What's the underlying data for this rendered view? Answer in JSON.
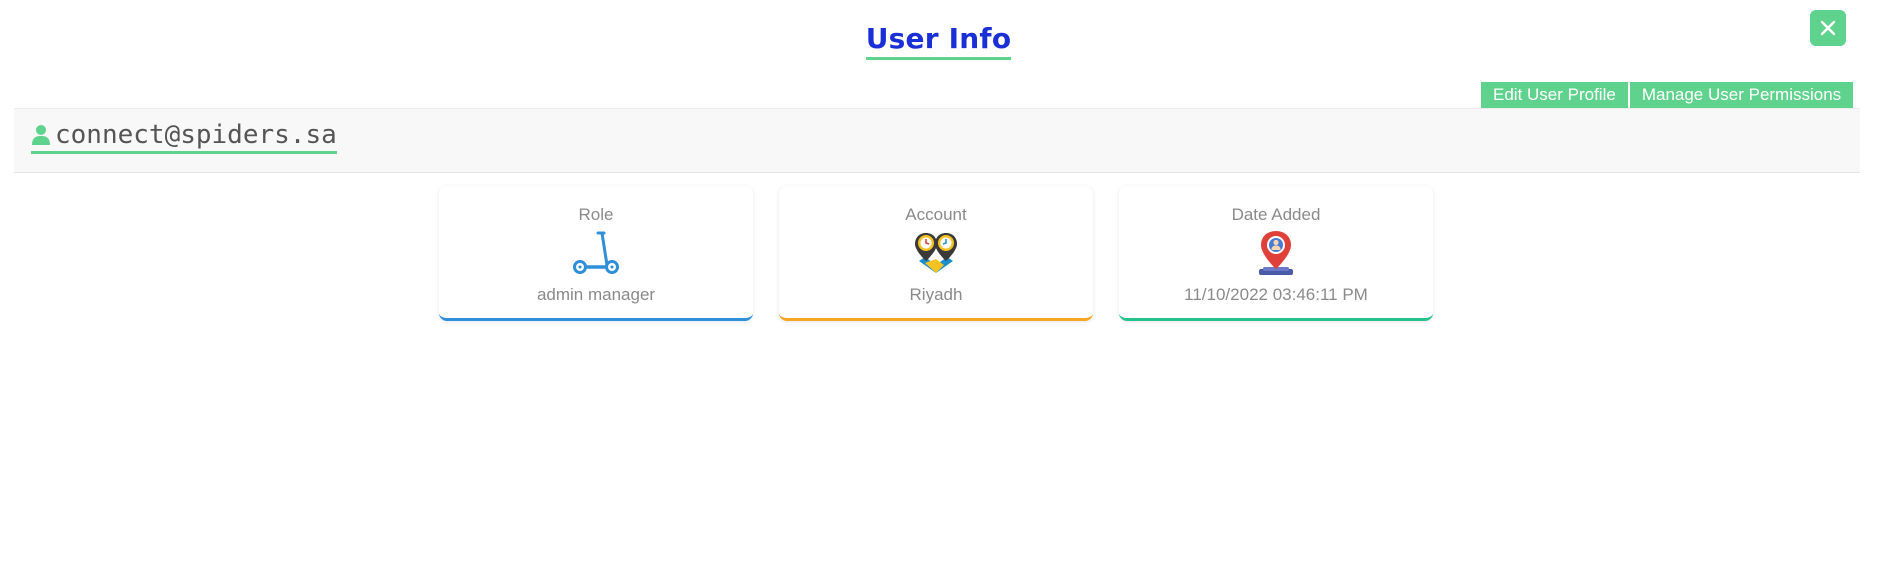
{
  "header": {
    "title": "User Info",
    "close_icon": "close-icon"
  },
  "actions": {
    "edit_profile": "Edit User Profile",
    "manage_permissions": "Manage User Permissions"
  },
  "user": {
    "icon": "user-icon",
    "email": "connect@spiders.sa"
  },
  "cards": [
    {
      "label": "Role",
      "icon": "scooter-icon",
      "value": "admin manager",
      "accent": "#2f8fd8"
    },
    {
      "label": "Account",
      "icon": "clock-pins-icon",
      "value": "Riyadh",
      "accent": "#f5a623"
    },
    {
      "label": "Date Added",
      "icon": "location-pin-icon",
      "value": "11/10/2022 03:46:11 PM",
      "accent": "#28c28e"
    }
  ],
  "colors": {
    "accent_green": "#5fd38d",
    "title_blue": "#1a2fd6"
  }
}
